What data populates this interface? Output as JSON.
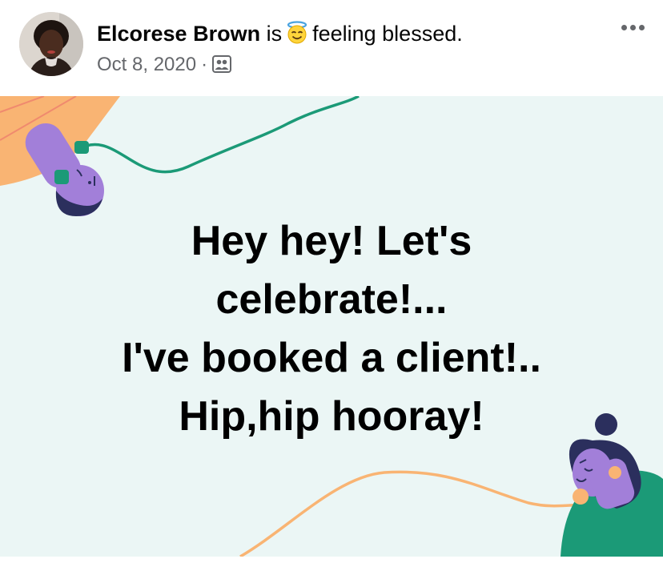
{
  "post": {
    "author": "Elcorese Brown",
    "status_prefix": "is",
    "feeling": "feeling blessed.",
    "feeling_icon": "smiling-face-with-halo-icon",
    "date": "Oct 8, 2020",
    "separator": "·",
    "audience_icon": "friends-audience-icon",
    "more_icon": "more-options-icon"
  },
  "image": {
    "message_lines": [
      "Hey hey! Let's",
      "celebrate!...",
      "I've booked a client!..",
      "Hip,hip hooray!"
    ],
    "background_color": "#ebf6f5"
  },
  "colors": {
    "text_primary": "#050505",
    "text_secondary": "#65676b",
    "accent_purple": "#a27fd9",
    "accent_green": "#1b9a77",
    "accent_orange": "#f9b473",
    "hair_navy": "#2b2f5d"
  }
}
